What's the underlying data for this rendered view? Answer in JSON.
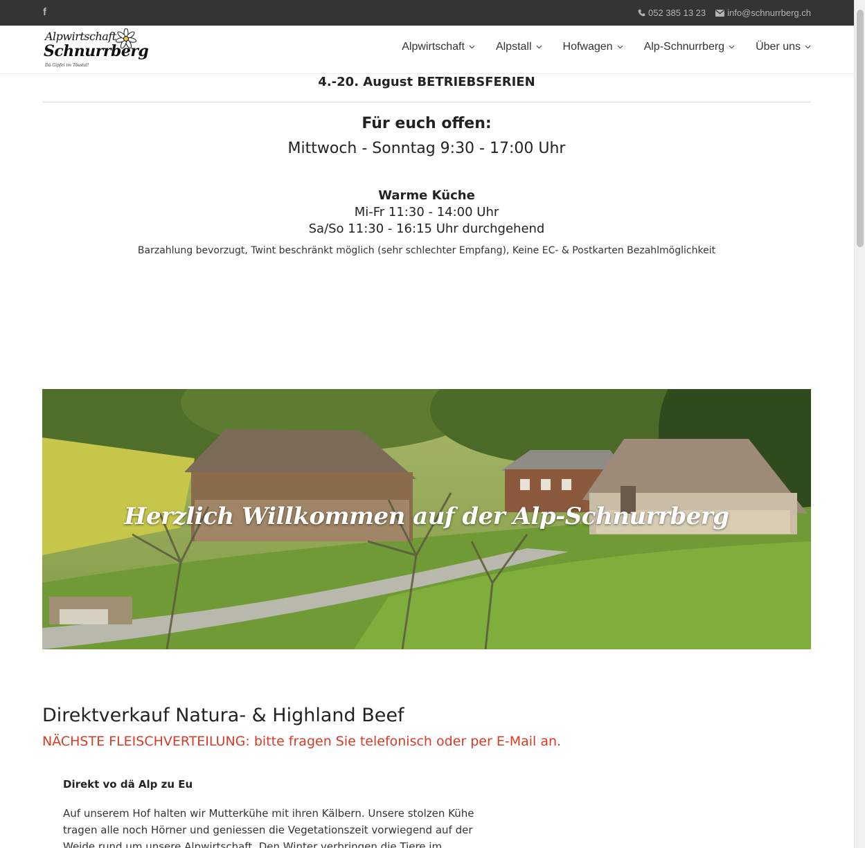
{
  "topbar": {
    "facebook_icon": "f",
    "phone": "052 385 13 23",
    "email": "info@schnurrberg.ch"
  },
  "logo": {
    "line1": "Alpwirtschaft",
    "line2": "Schnurrberg",
    "tagline": "Dä Gipfel im Tösstal!"
  },
  "nav": {
    "items": [
      {
        "label": "Alpwirtschaft"
      },
      {
        "label": "Alpstall"
      },
      {
        "label": "Hofwagen"
      },
      {
        "label": "Alp-Schnurrberg"
      },
      {
        "label": "Über uns"
      }
    ]
  },
  "notice": "4.-20. August BETRIEBSFERIEN",
  "opening": {
    "title": "Für euch offen:",
    "hours": "Mittwoch - Sonntag 9:30 - 17:00 Uhr"
  },
  "kitchen": {
    "title": "Warme Küche",
    "line1": "Mi-Fr 11:30 - 14:00 Uhr",
    "line2": "Sa/So 11:30 - 16:15 Uhr durchgehend"
  },
  "payment": "Barzahlung bevorzugt, Twint beschränkt möglich (sehr schlechter Empfang), Keine EC- & Postkarten Bezahlmöglichkeit",
  "hero": {
    "title": "Herzlich Willkommen auf der Alp-Schnurrberg"
  },
  "sale": {
    "title": "Direktverkauf Natura- & Highland Beef",
    "subtitle": "NÄCHSTE FLEISCHVERTEILUNG: bitte fragen Sie telefonisch oder per E-Mail an."
  },
  "intro": {
    "heading": "Direkt vo dä Alp zu Eu",
    "lines": [
      "Auf unserem Hof halten wir Mutterkühe mit ihren Kälbern. Unsere stolzen Kühe",
      "tragen alle noch Hörner und geniessen die Vegetationszeit vorwiegend auf der",
      "Weide rund um unsere Alpwirtschaft. Den Winter verbringen die Tiere im"
    ]
  },
  "colors": {
    "topbar_bg": "#343434",
    "accent_red": "#d93a25",
    "text": "#222222"
  }
}
